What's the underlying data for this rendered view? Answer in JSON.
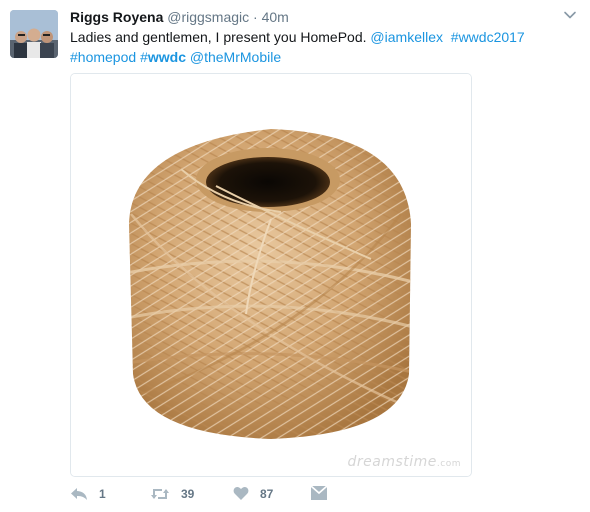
{
  "tweet": {
    "display_name": "Riggs Royena",
    "handle": "@riggsmagic",
    "separator": "·",
    "timestamp": "40m",
    "text": {
      "plain": "Ladies and gentlemen, I present you HomePod. ",
      "mention1": "@iamkellex",
      "hashtag1": "#wwdc2017",
      "hashtag2": "#homepod",
      "hashtag3_prefix": "#",
      "hashtag3_bold": "wwdc",
      "mention2": "@theMrMobile"
    },
    "media": {
      "subject": "ball of twine",
      "watermark": "dreamstime",
      "watermark_suffix": ".com"
    }
  },
  "actions": {
    "reply_count": "1",
    "retweet_count": "39",
    "like_count": "87"
  },
  "icons": {
    "reply": "reply-icon",
    "retweet": "retweet-icon",
    "like": "heart-icon",
    "message": "envelope-icon",
    "more": "chevron-down-icon"
  },
  "colors": {
    "link": "#1b95e0",
    "meta": "#657786",
    "text": "#14171a",
    "border": "#e1e8ed"
  }
}
